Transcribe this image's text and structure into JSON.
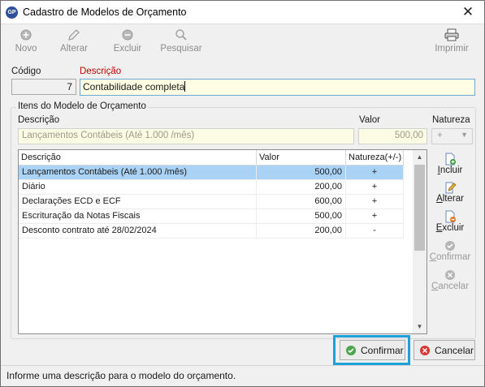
{
  "window": {
    "app_icon_text": "GP",
    "title": "Cadastro de Modelos de Orçamento",
    "close": "✕"
  },
  "toolbar": {
    "novo": "Novo",
    "alterar": "Alterar",
    "excluir": "Excluir",
    "pesquisar": "Pesquisar",
    "imprimir": "Imprimir"
  },
  "header": {
    "codigo_label": "Código",
    "codigo_value": "7",
    "descricao_label": "Descrição",
    "descricao_value": "Contabilidade completa"
  },
  "items_group": {
    "title": "Itens do Modelo de Orçamento",
    "descricao_label": "Descrição",
    "valor_label": "Valor",
    "natureza_label": "Natureza",
    "descricao_value": "Lançamentos Contábeis (Até 1.000 /mês)",
    "valor_value": "500,00",
    "natureza_value": "+"
  },
  "grid": {
    "columns": [
      "Descrição",
      "Valor",
      "Natureza(+/-)"
    ],
    "rows": [
      {
        "descricao": "Lançamentos Contábeis (Até 1.000 /mês)",
        "valor": "500,00",
        "natureza": "+"
      },
      {
        "descricao": "Diário",
        "valor": "200,00",
        "natureza": "+"
      },
      {
        "descricao": "Declarações ECD e ECF",
        "valor": "600,00",
        "natureza": "+"
      },
      {
        "descricao": "Escrituração da Notas Fiscais",
        "valor": "500,00",
        "natureza": "+"
      },
      {
        "descricao": "Desconto contrato até 28/02/2024",
        "valor": "200,00",
        "natureza": "-"
      }
    ],
    "selected_row": 0
  },
  "side_buttons": {
    "incluir_first": "I",
    "incluir_rest": "ncluir",
    "alterar_first": "A",
    "alterar_rest": "lterar",
    "excluir_first": "E",
    "excluir_rest": "xcluir",
    "confirmar_first": "C",
    "confirmar_rest": "onfirmar",
    "cancelar_first": "C",
    "cancelar_rest": "ancelar"
  },
  "footer": {
    "confirmar": "Confirmar",
    "cancelar": "Cancelar"
  },
  "status": {
    "message": "Informe uma descrição para o modelo do orçamento."
  },
  "colors": {
    "accent_highlight": "#1fa0d8",
    "selected_row": "#a9d2f5",
    "required_label": "#c00000",
    "input_bg": "#fffde3"
  }
}
